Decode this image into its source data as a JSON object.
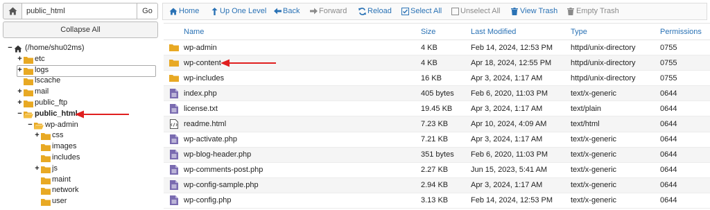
{
  "left": {
    "path_value": "public_html",
    "go_label": "Go",
    "collapse_label": "Collapse All",
    "tree": [
      {
        "label": "(/home/shu02ms)",
        "depth": 0,
        "toggle": "−",
        "icon": "home-icon"
      },
      {
        "label": "etc",
        "depth": 1,
        "toggle": "+",
        "icon": "folder-icon"
      },
      {
        "label": "logs",
        "depth": 1,
        "toggle": "+",
        "icon": "folder-icon"
      },
      {
        "label": "lscache",
        "depth": 1,
        "toggle": "",
        "icon": "folder-icon"
      },
      {
        "label": "mail",
        "depth": 1,
        "toggle": "+",
        "icon": "folder-icon"
      },
      {
        "label": "public_ftp",
        "depth": 1,
        "toggle": "+",
        "icon": "folder-icon"
      },
      {
        "label": "public_html",
        "depth": 1,
        "toggle": "−",
        "icon": "folder-open-icon",
        "active": true
      },
      {
        "label": "wp-admin",
        "depth": 2,
        "toggle": "−",
        "icon": "folder-open-icon"
      },
      {
        "label": "css",
        "depth": 3,
        "toggle": "+",
        "icon": "folder-icon"
      },
      {
        "label": "images",
        "depth": 3,
        "toggle": "",
        "icon": "folder-icon"
      },
      {
        "label": "includes",
        "depth": 3,
        "toggle": "",
        "icon": "folder-icon"
      },
      {
        "label": "js",
        "depth": 3,
        "toggle": "+",
        "icon": "folder-icon"
      },
      {
        "label": "maint",
        "depth": 3,
        "toggle": "",
        "icon": "folder-icon"
      },
      {
        "label": "network",
        "depth": 3,
        "toggle": "",
        "icon": "folder-icon"
      },
      {
        "label": "user",
        "depth": 3,
        "toggle": "",
        "icon": "folder-icon"
      }
    ]
  },
  "toolbar": {
    "home": "Home",
    "up_one_level": "Up One Level",
    "back": "Back",
    "forward": "Forward",
    "reload": "Reload",
    "select_all": "Select All",
    "unselect_all": "Unselect All",
    "view_trash": "View Trash",
    "empty_trash": "Empty Trash"
  },
  "table": {
    "headers": {
      "name": "Name",
      "size": "Size",
      "modified": "Last Modified",
      "type": "Type",
      "permissions": "Permissions"
    },
    "rows": [
      {
        "icon": "folder-icon",
        "name": "wp-admin",
        "size": "4 KB",
        "modified": "Feb 14, 2024, 12:53 PM",
        "type": "httpd/unix-directory",
        "perm": "0755"
      },
      {
        "icon": "folder-icon",
        "name": "wp-content",
        "size": "4 KB",
        "modified": "Apr 18, 2024, 12:55 PM",
        "type": "httpd/unix-directory",
        "perm": "0755"
      },
      {
        "icon": "folder-icon",
        "name": "wp-includes",
        "size": "16 KB",
        "modified": "Apr 3, 2024, 1:17 AM",
        "type": "httpd/unix-directory",
        "perm": "0755"
      },
      {
        "icon": "php-file-icon",
        "name": "index.php",
        "size": "405 bytes",
        "modified": "Feb 6, 2020, 11:03 PM",
        "type": "text/x-generic",
        "perm": "0644"
      },
      {
        "icon": "text-file-icon",
        "name": "license.txt",
        "size": "19.45 KB",
        "modified": "Apr 3, 2024, 1:17 AM",
        "type": "text/plain",
        "perm": "0644"
      },
      {
        "icon": "html-file-icon",
        "name": "readme.html",
        "size": "7.23 KB",
        "modified": "Apr 10, 2024, 4:09 AM",
        "type": "text/html",
        "perm": "0644"
      },
      {
        "icon": "php-file-icon",
        "name": "wp-activate.php",
        "size": "7.21 KB",
        "modified": "Apr 3, 2024, 1:17 AM",
        "type": "text/x-generic",
        "perm": "0644"
      },
      {
        "icon": "php-file-icon",
        "name": "wp-blog-header.php",
        "size": "351 bytes",
        "modified": "Feb 6, 2020, 11:03 PM",
        "type": "text/x-generic",
        "perm": "0644"
      },
      {
        "icon": "php-file-icon",
        "name": "wp-comments-post.php",
        "size": "2.27 KB",
        "modified": "Jun 15, 2023, 5:41 AM",
        "type": "text/x-generic",
        "perm": "0644"
      },
      {
        "icon": "php-file-icon",
        "name": "wp-config-sample.php",
        "size": "2.94 KB",
        "modified": "Apr 3, 2024, 1:17 AM",
        "type": "text/x-generic",
        "perm": "0644"
      },
      {
        "icon": "php-file-icon",
        "name": "wp-config.php",
        "size": "3.13 KB",
        "modified": "Feb 14, 2024, 12:53 PM",
        "type": "text/x-generic",
        "perm": "0644"
      }
    ]
  },
  "colors": {
    "link_blue": "#2a72b5",
    "folder_yellow": "#e8a924",
    "file_purple": "#7a6bb0",
    "annotation_red": "#e01f1f"
  }
}
